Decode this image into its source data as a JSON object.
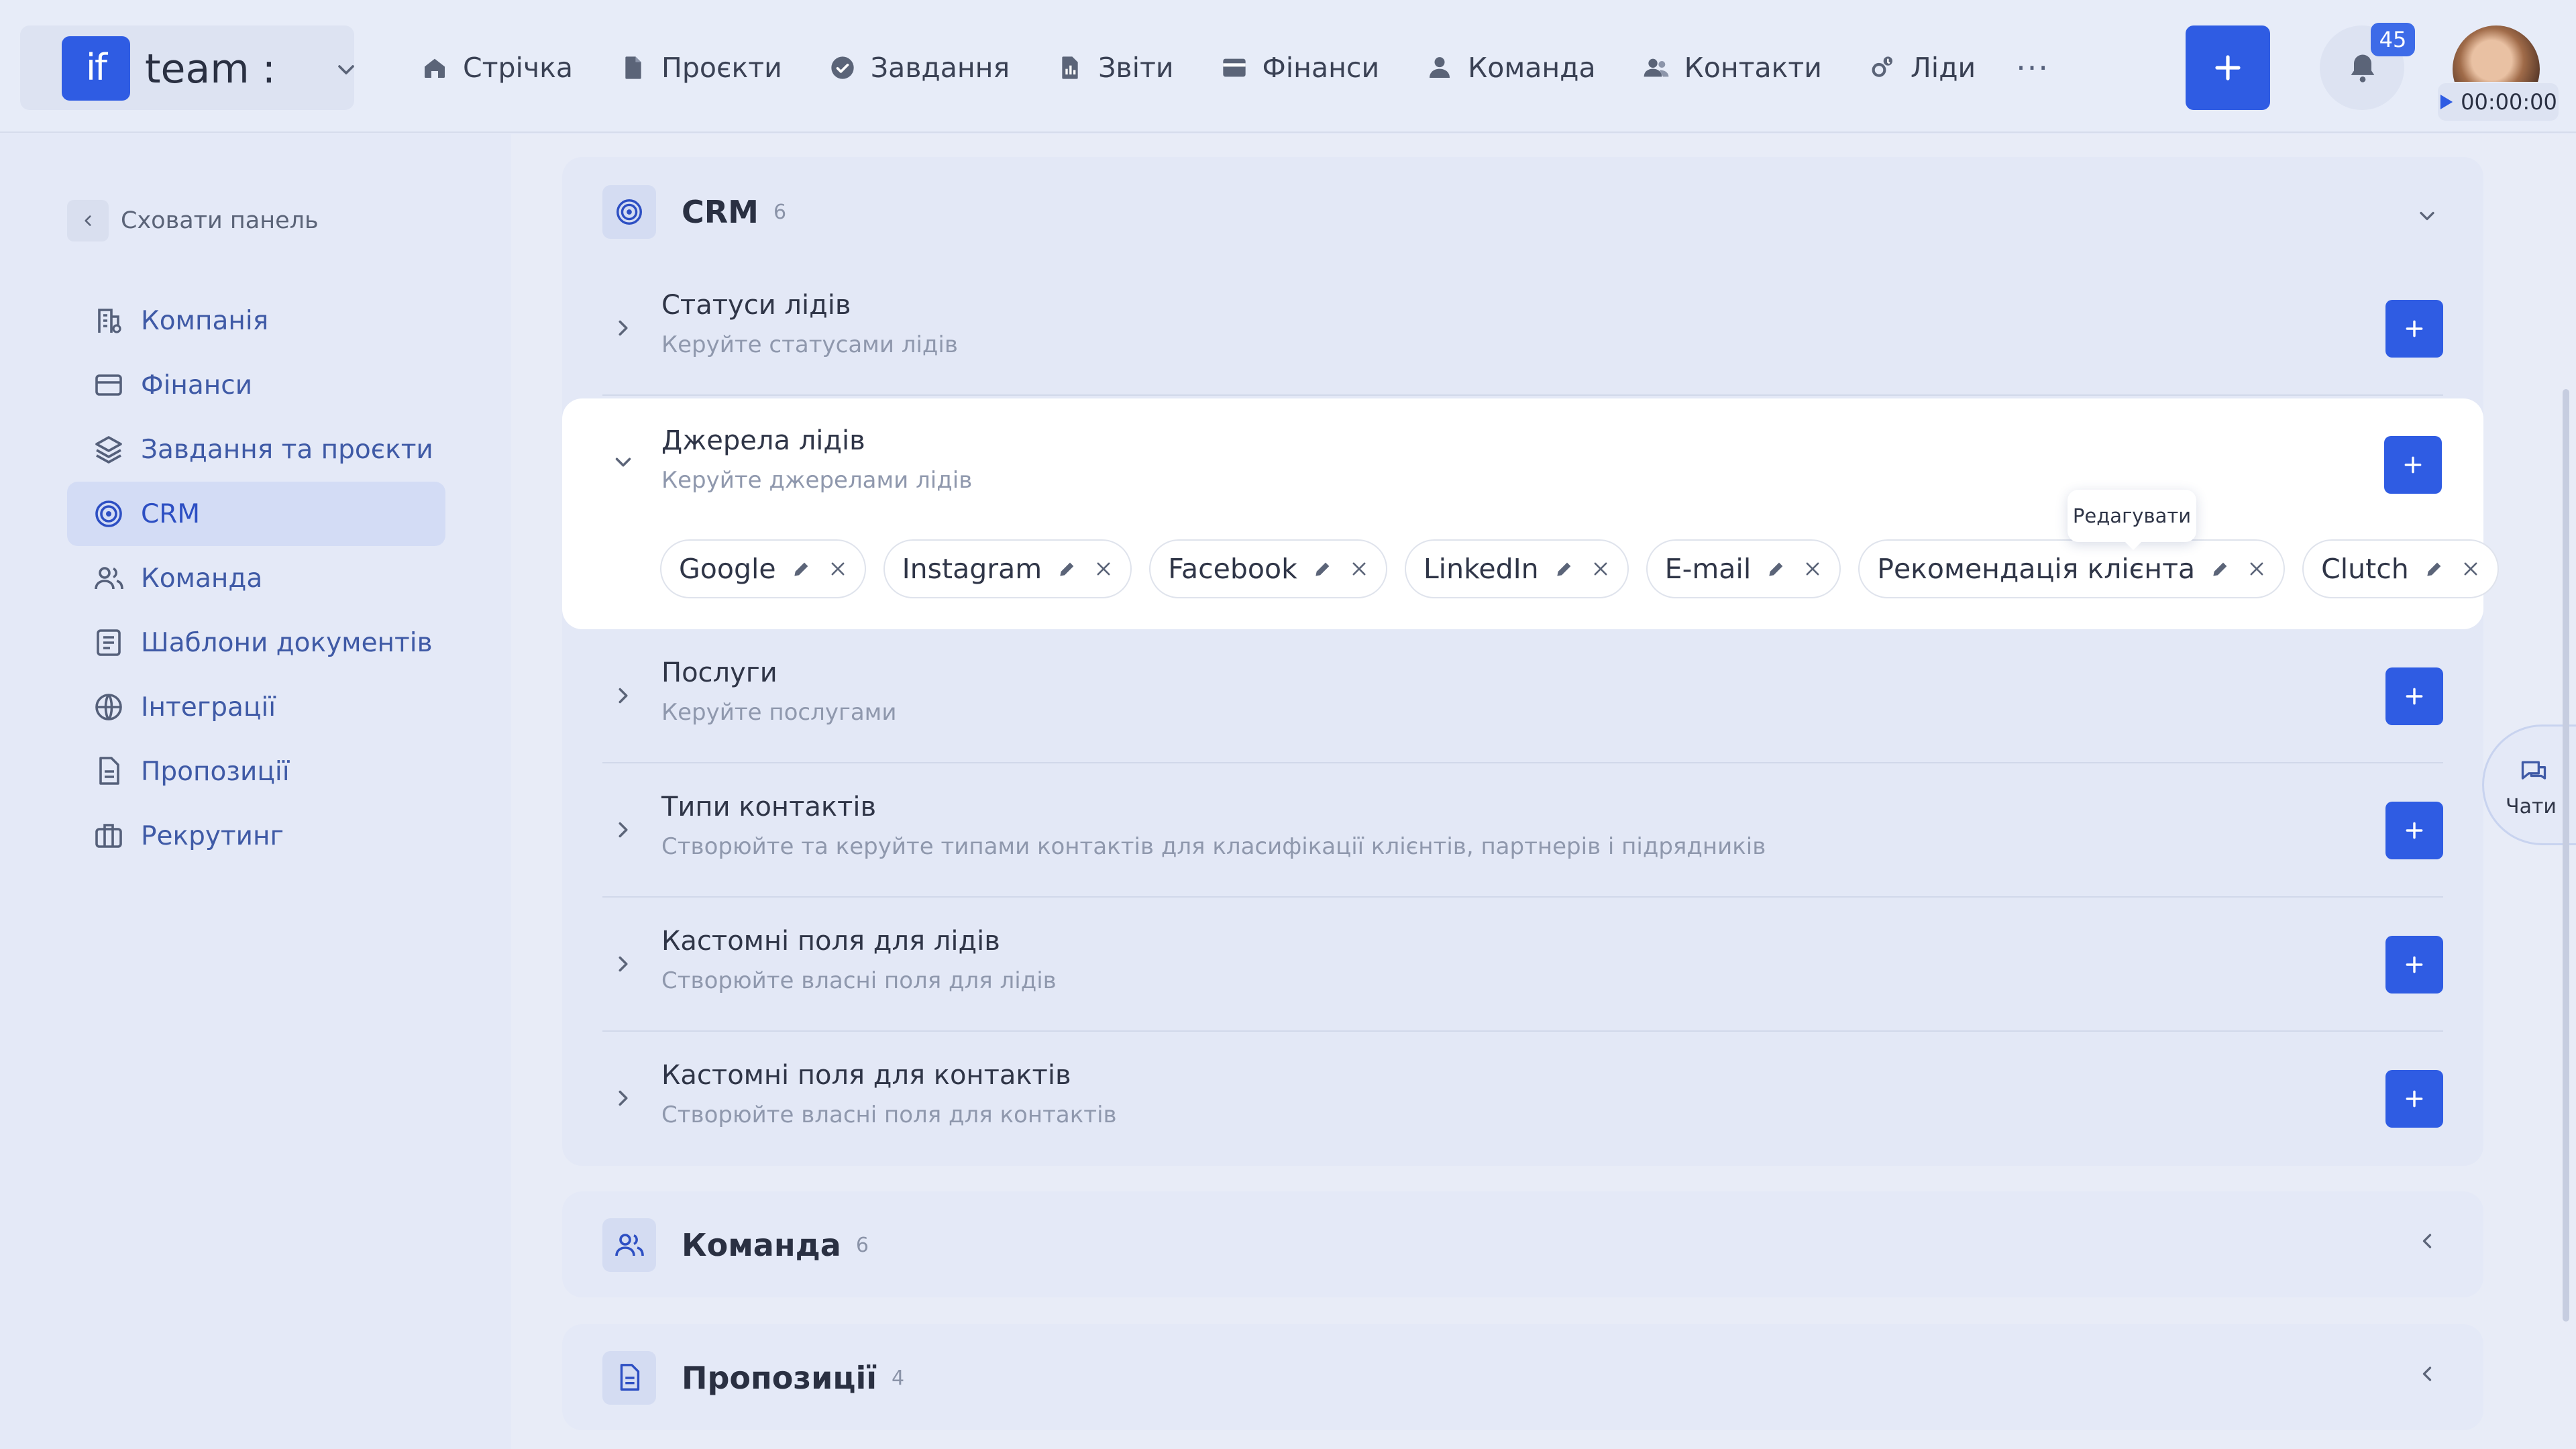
{
  "brand": {
    "logo_text": "if",
    "name": "team :"
  },
  "nav": [
    {
      "label": "Стрічка",
      "icon": "home-icon"
    },
    {
      "label": "Проєкти",
      "icon": "document-icon"
    },
    {
      "label": "Завдання",
      "icon": "check-circle-icon"
    },
    {
      "label": "Звіти",
      "icon": "report-icon"
    },
    {
      "label": "Фінанси",
      "icon": "wallet-icon"
    },
    {
      "label": "Команда",
      "icon": "user-icon"
    },
    {
      "label": "Контакти",
      "icon": "contacts-icon"
    },
    {
      "label": "Ліди",
      "icon": "leads-icon"
    }
  ],
  "nav_more": "···",
  "notifications": {
    "count": "45"
  },
  "timer": "00:00:00",
  "sidebar": {
    "hide_label": "Сховати панель",
    "items": [
      {
        "label": "Компанія",
        "icon": "company-icon"
      },
      {
        "label": "Фінанси",
        "icon": "card-icon"
      },
      {
        "label": "Завдання та проєкти",
        "icon": "layers-icon"
      },
      {
        "label": "CRM",
        "icon": "target-icon",
        "active": true
      },
      {
        "label": "Команда",
        "icon": "team-icon"
      },
      {
        "label": "Шаблони документів",
        "icon": "template-icon"
      },
      {
        "label": "Інтеграції",
        "icon": "globe-icon"
      },
      {
        "label": "Пропозиції",
        "icon": "file-icon"
      },
      {
        "label": "Рекрутинг",
        "icon": "briefcase-icon"
      }
    ]
  },
  "crm": {
    "title": "CRM",
    "count": "6",
    "rows": [
      {
        "title": "Статуси лідів",
        "desc": "Керуйте статусами лідів"
      },
      {
        "title": "Джерела лідів",
        "desc": "Керуйте джерелами лідів",
        "expanded": true
      },
      {
        "title": "Послуги",
        "desc": "Керуйте послугами"
      },
      {
        "title": "Типи контактів",
        "desc": "Створюйте та керуйте типами контактів для класифікації клієнтів, партнерів і підрядників"
      },
      {
        "title": "Кастомні поля для лідів",
        "desc": "Створюйте власні поля для лідів"
      },
      {
        "title": "Кастомні поля для контактів",
        "desc": "Створюйте власні поля для контактів"
      }
    ],
    "sources": [
      "Google",
      "Instagram",
      "Facebook",
      "LinkedIn",
      "E-mail",
      "Рекомендація клієнта",
      "Clutch"
    ],
    "tooltip": "Редагувати"
  },
  "team_section": {
    "title": "Команда",
    "count": "6"
  },
  "proposals_section": {
    "title": "Пропозиції",
    "count": "4"
  },
  "chats": {
    "label": "Чати"
  },
  "colors": {
    "accent": "#2f5ce3",
    "background": "#e4e9f7",
    "active_item": "#d3dcf5"
  }
}
